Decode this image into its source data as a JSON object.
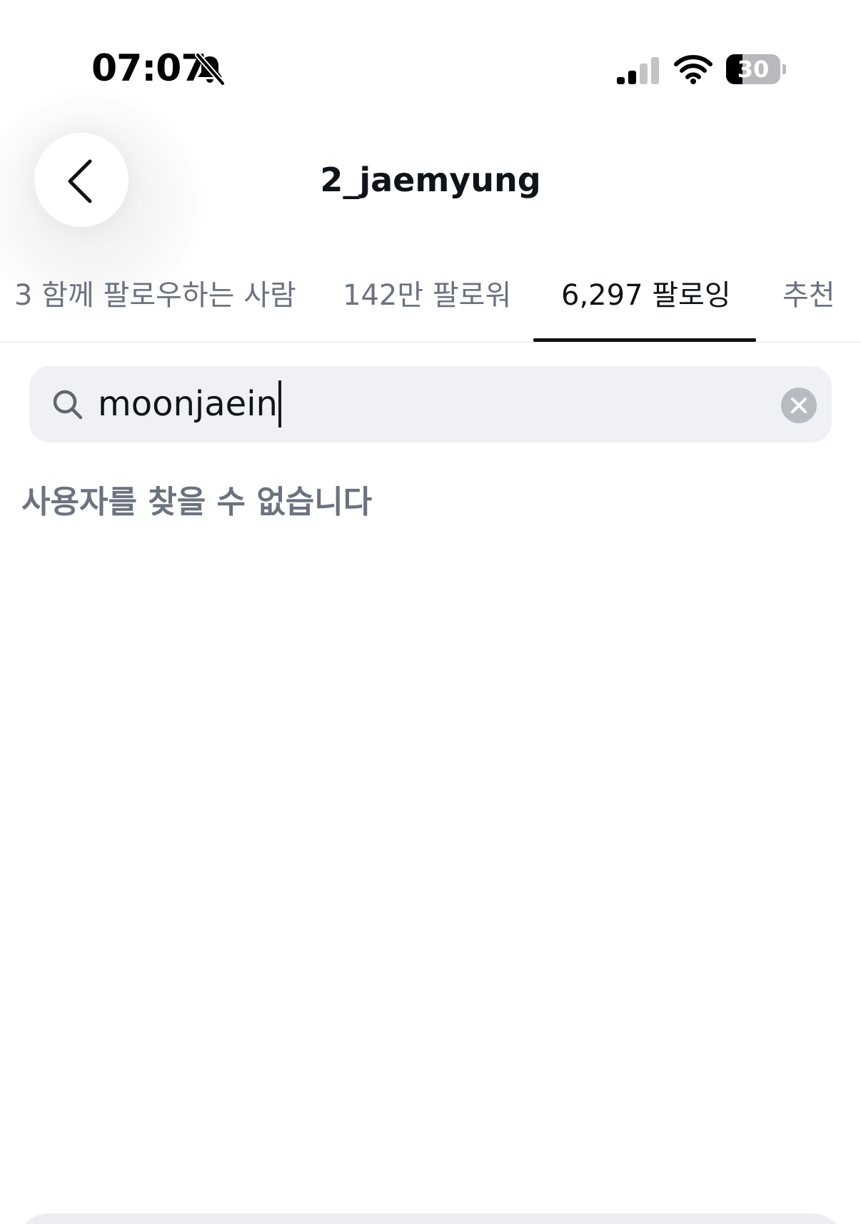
{
  "status_bar": {
    "time": "07:07",
    "battery_level": "30",
    "battery_fraction": 0.3,
    "cellular_bars_active": 2,
    "cellular_bars_total": 4,
    "icons": [
      "bell-slash-icon",
      "cellular-signal-icon",
      "wifi-icon",
      "battery-icon"
    ]
  },
  "header": {
    "title": "2_jaemyung",
    "back_icon": "chevron-left-icon"
  },
  "tabs": [
    {
      "label": "3 함께 팔로우하는 사람",
      "active": false
    },
    {
      "label": "142만 팔로워",
      "active": false
    },
    {
      "label": "6,297 팔로잉",
      "active": true
    },
    {
      "label": "추천",
      "active": false
    }
  ],
  "search": {
    "value": "moonjaein",
    "icon": "search-icon",
    "clear_icon": "clear-x-icon"
  },
  "results": {
    "empty_message": "사용자를 찾을 수 없습니다"
  },
  "colors": {
    "text_primary": "#0f1419",
    "text_secondary": "#6b7280",
    "search_bg": "#eff1f4",
    "divider": "#e6e8eb"
  }
}
